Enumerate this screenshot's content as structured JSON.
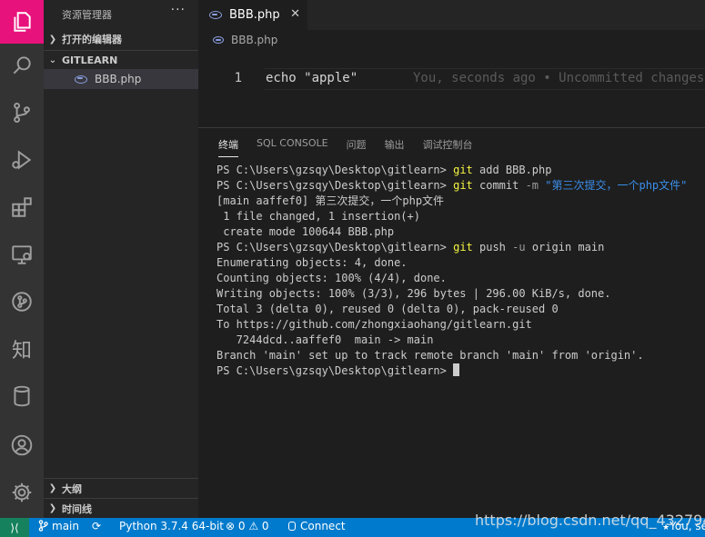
{
  "sidebar": {
    "title": "资源管理器",
    "more": "···",
    "open_editors": "打开的编辑器",
    "folder": "GITLEARN",
    "file": "BBB.php",
    "outline": "大纲",
    "timeline": "时间线"
  },
  "activity": {
    "zhi": "知"
  },
  "editor": {
    "tab": "BBB.php",
    "breadcrumb": "BBB.php",
    "line_number": "1",
    "code": "echo \"apple\"",
    "blame": "You, seconds ago • Uncommitted changes"
  },
  "panel": {
    "tabs": [
      "终端",
      "SQL CONSOLE",
      "问题",
      "输出",
      "调试控制台"
    ],
    "prompt": "PS C:\\Users\\gzsqy\\Desktop\\gitlearn> ",
    "cmd1": {
      "git": "git",
      "rest": " add BBB.php"
    },
    "cmd2": {
      "git": "git",
      "mid": " commit ",
      "flag": "-m",
      "msg": " \"第三次提交，一个php文件\""
    },
    "out1": "[main aaffef0] 第三次提交，一个php文件",
    "out2": " 1 file changed, 1 insertion(+)",
    "out3": " create mode 100644 BBB.php",
    "cmd3": {
      "git": "git",
      "mid": " push ",
      "flag": "-u",
      "rest": " origin main"
    },
    "out4": "Enumerating objects: 4, done.",
    "out5": "Counting objects: 100% (4/4), done.",
    "out6": "Writing objects: 100% (3/3), 296 bytes | 296.00 KiB/s, done.",
    "out7": "Total 3 (delta 0), reused 0 (delta 0), pack-reused 0",
    "out8": "To https://github.com/zhongxiaohang/gitlearn.git",
    "out9": "   7244dcd..aaffef0  main -> main",
    "out10": "Branch 'main' set up to track remote branch 'main' from 'origin'."
  },
  "status": {
    "remote": "⟩⟨",
    "branch": "main",
    "python": "Python 3.7.4 64-bit",
    "problems": "⊗ 0 ⚠ 0",
    "connect": "Connect",
    "blame_short": "You, se"
  },
  "watermark": "https://blog.csdn.net/qq_43279457",
  "colors": {
    "accent": "#e8127c",
    "statusbar": "#007acc",
    "remote": "#16825d"
  }
}
